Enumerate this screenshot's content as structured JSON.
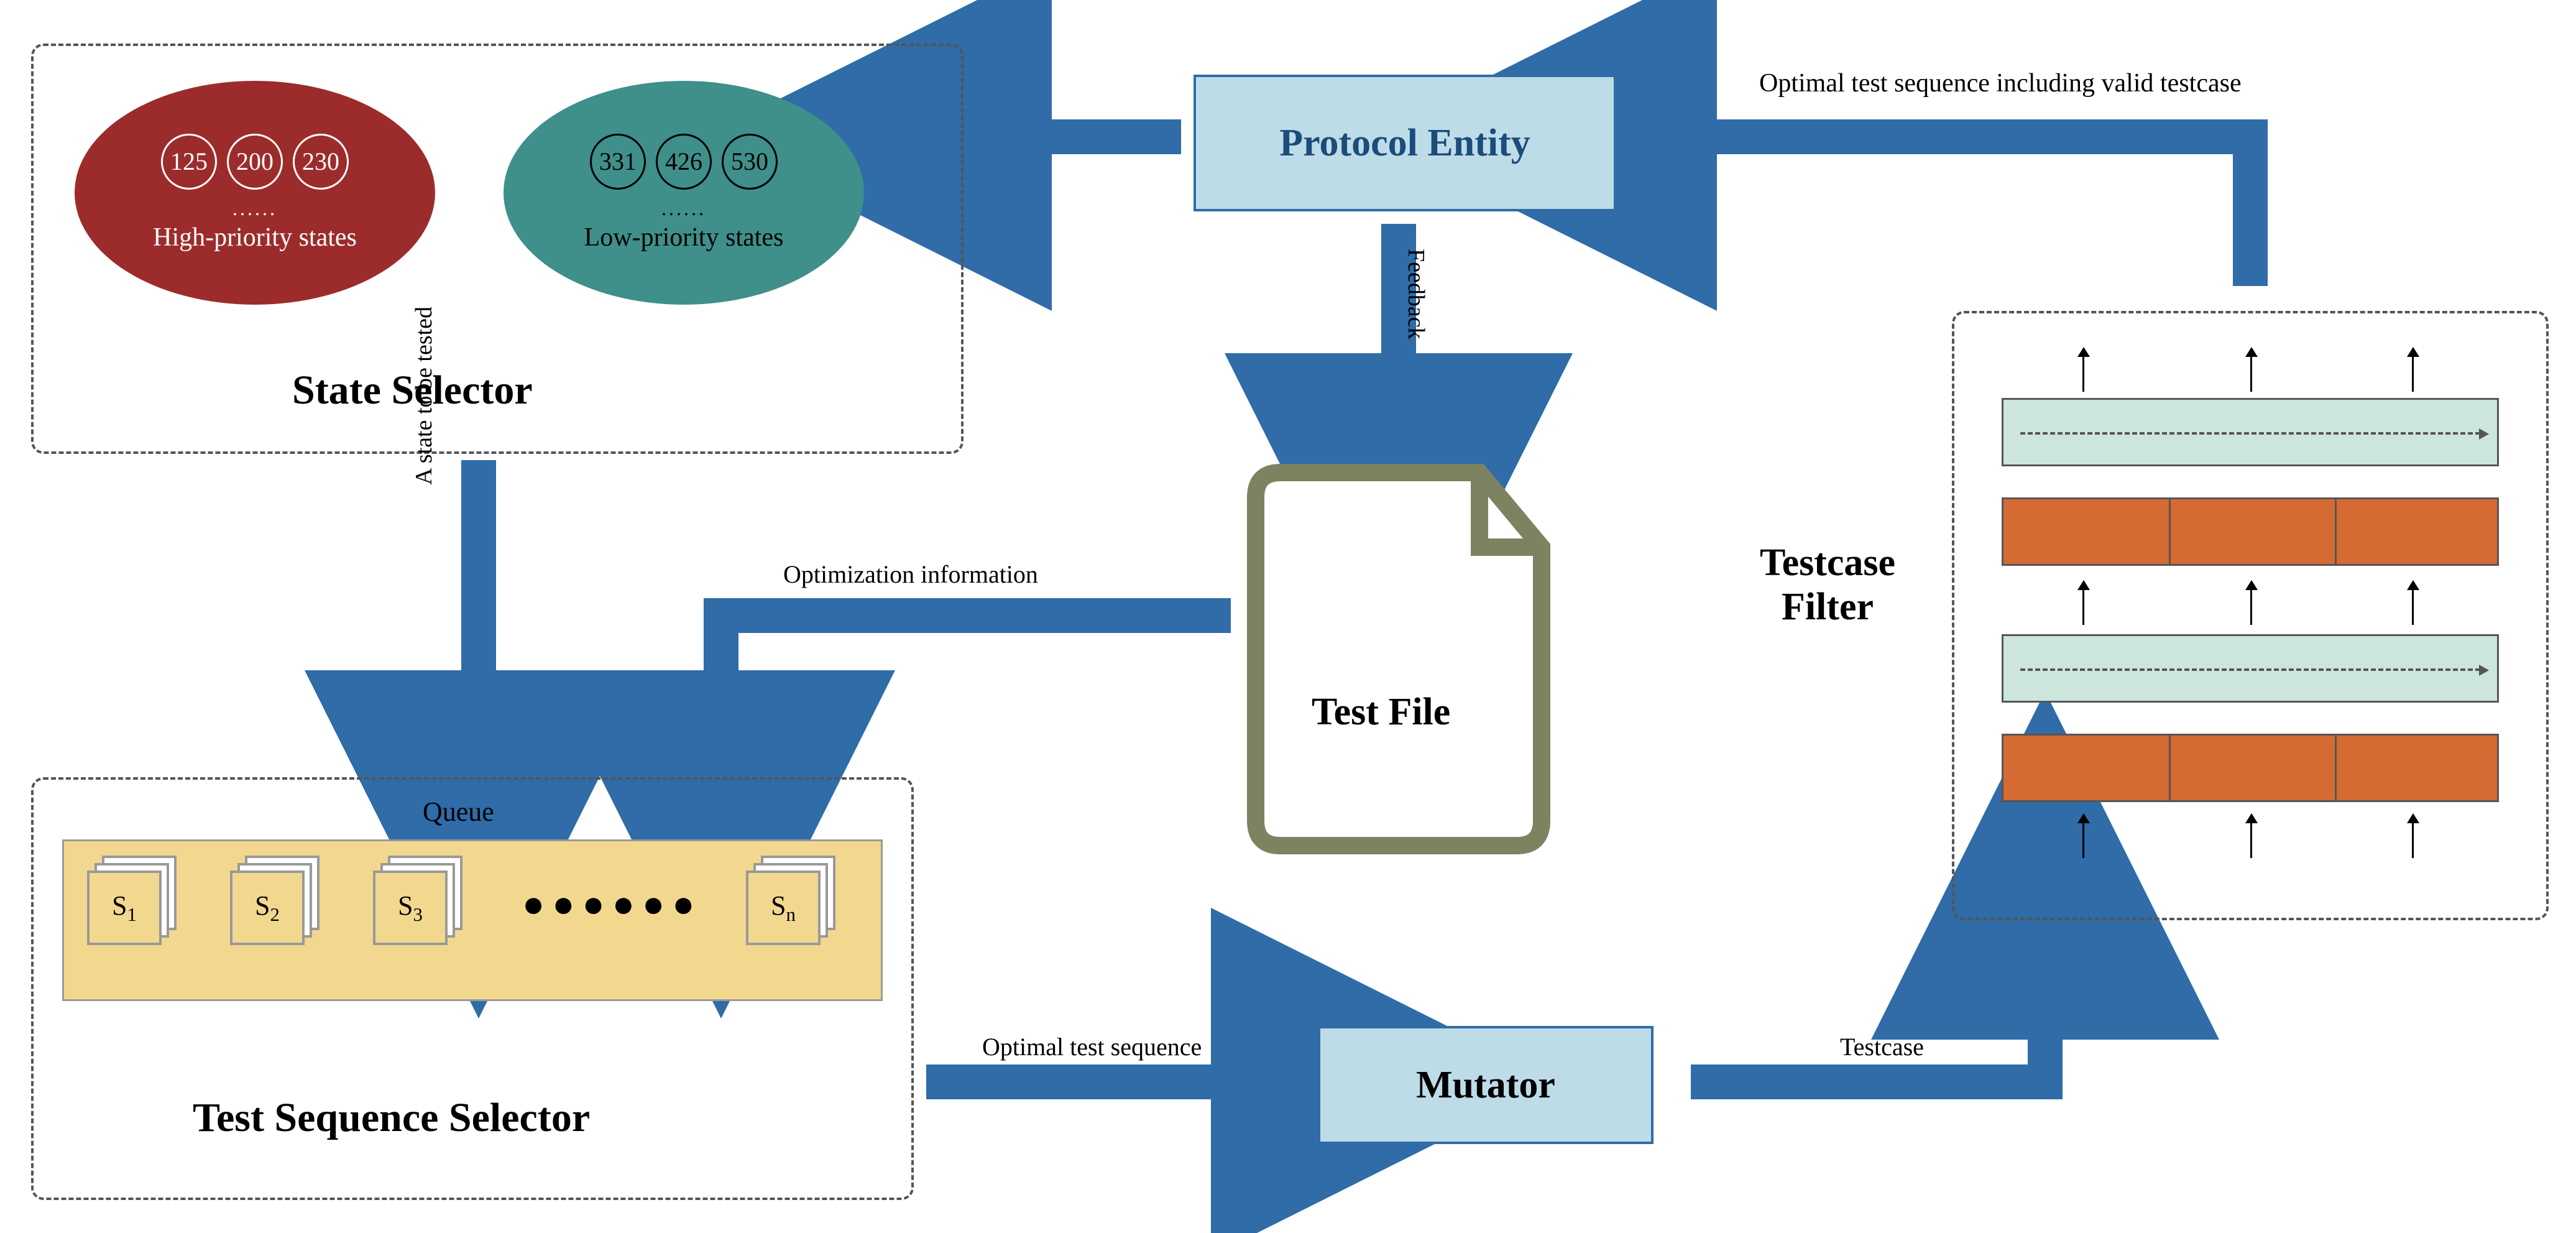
{
  "boxes": {
    "protocol_entity": "Protocol Entity",
    "state_selector": "State Selector",
    "test_sequence_selector": "Test Sequence Selector",
    "mutator": "Mutator",
    "testcase_filter_line1": "Testcase",
    "testcase_filter_line2": "Filter",
    "test_file": "Test File"
  },
  "state_selector": {
    "high_priority": {
      "label": "High-priority states",
      "codes": [
        "125",
        "200",
        "230"
      ],
      "dots": "......"
    },
    "low_priority": {
      "label": "Low-priority states",
      "codes": [
        "331",
        "426",
        "530"
      ],
      "dots": "......"
    }
  },
  "queue": {
    "title": "Queue",
    "items": [
      "S",
      "S",
      "S",
      "S"
    ],
    "subs": [
      "1",
      "2",
      "3",
      "n"
    ],
    "dots": "●●●●●●"
  },
  "arrows": {
    "a_state_to_be_tested": "A state to be tested",
    "optimization_information": "Optimization information",
    "feedback": "Feedback",
    "optimal_test_sequence": "Optimal test sequence",
    "testcase": "Testcase",
    "optimal_valid": "Optimal test sequence including valid testcase"
  },
  "colors": {
    "arrow": "#2f6ca8",
    "box_fill": "#bedbe8",
    "high_ellipse": "#9c2c2c",
    "low_ellipse": "#3f8f8a",
    "queue_fill": "#f2d88f",
    "filter_green": "#cde6dc",
    "filter_orange": "#d66a33",
    "file_stroke": "#7d8360"
  }
}
